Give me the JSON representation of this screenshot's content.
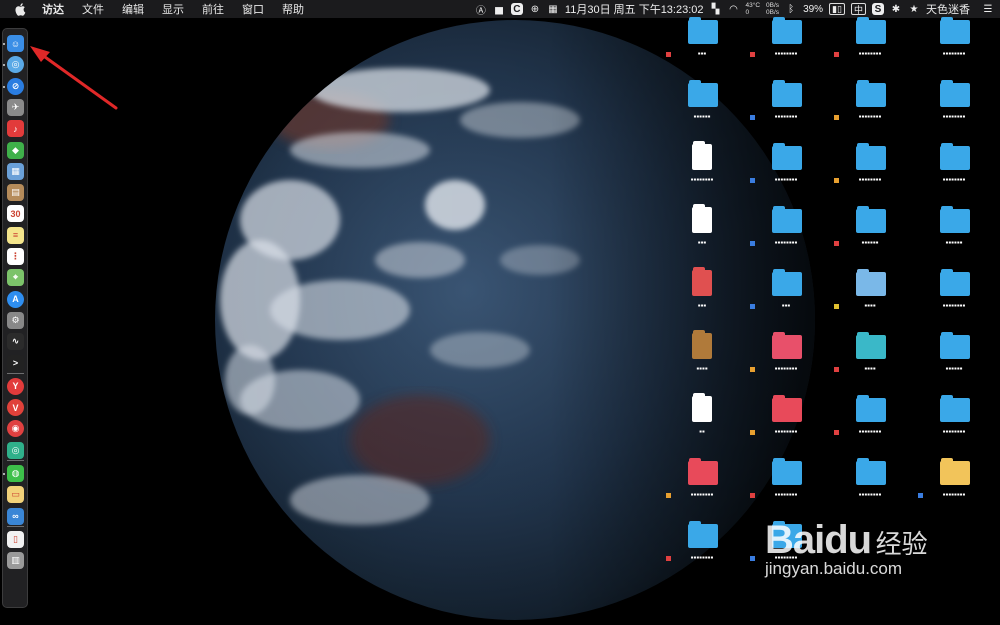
{
  "menubar": {
    "app": "访达",
    "items": [
      "文件",
      "编辑",
      "显示",
      "前往",
      "窗口",
      "帮助"
    ],
    "status": {
      "net_up": "0B/s",
      "net_down": "0B/s",
      "temp": "43°C",
      "temp_sub": "0",
      "clock": "11月30日 周五 下午13:23:02",
      "battery": "39%",
      "input_method": "中",
      "s_badge": "S",
      "c_badge": "C",
      "theme": "天色迷香"
    }
  },
  "dock": {
    "apps": [
      {
        "name": "finder",
        "color": "#3a8ee6",
        "glyph": "☺"
      },
      {
        "name": "safari-alt",
        "color": "#5aa9e6",
        "glyph": "◎"
      },
      {
        "name": "safari",
        "color": "#2a7de1",
        "glyph": "⊘"
      },
      {
        "name": "launchpad",
        "color": "#8a8a8a",
        "glyph": "✈"
      },
      {
        "name": "netease",
        "color": "#e23b3b",
        "glyph": "♪"
      },
      {
        "name": "android",
        "color": "#3fb04a",
        "glyph": "◆"
      },
      {
        "name": "preview",
        "color": "#6aa0d8",
        "glyph": "▦"
      },
      {
        "name": "contacts",
        "color": "#b58b5a",
        "glyph": "▤"
      },
      {
        "name": "calendar",
        "color": "#ffffff",
        "glyph": "30"
      },
      {
        "name": "notes",
        "color": "#f4e58c",
        "glyph": "≡"
      },
      {
        "name": "reminders",
        "color": "#ffffff",
        "glyph": "⋮"
      },
      {
        "name": "maps",
        "color": "#7cc36a",
        "glyph": "⌖"
      },
      {
        "name": "app-store",
        "color": "#2e8ef0",
        "glyph": "A"
      },
      {
        "name": "system-preferences",
        "color": "#888888",
        "glyph": "⚙"
      },
      {
        "name": "activity-monitor",
        "color": "#2b2b2b",
        "glyph": "∿"
      },
      {
        "name": "terminal",
        "color": "#222222",
        "glyph": ">"
      },
      {
        "name": "yandex",
        "color": "#e23b3b",
        "glyph": "Y"
      },
      {
        "name": "vivaldi",
        "color": "#e0413a",
        "glyph": "V"
      },
      {
        "name": "weibo",
        "color": "#e04040",
        "glyph": "◉"
      },
      {
        "name": "green-app",
        "color": "#2fb08a",
        "glyph": "◎"
      },
      {
        "name": "wechat",
        "color": "#3dc04a",
        "glyph": "◍"
      },
      {
        "name": "sticky",
        "color": "#f2d27a",
        "glyph": "▭"
      },
      {
        "name": "infinity",
        "color": "#3a86d6",
        "glyph": "∞"
      },
      {
        "name": "document",
        "color": "#f2f2f2",
        "glyph": "▯"
      },
      {
        "name": "trash",
        "color": "#9a9a9a",
        "glyph": "▥"
      }
    ]
  },
  "desktop": {
    "items": [
      {
        "kind": "folder",
        "color": "#3aa8e8",
        "tag": "#e04040",
        "label": "▪▪▪"
      },
      {
        "kind": "folder",
        "color": "#3aa8e8",
        "tag": "#e04040",
        "label": "▪▪▪▪▪▪▪▪"
      },
      {
        "kind": "folder",
        "color": "#3aa8e8",
        "tag": "#e04040",
        "label": "▪▪▪▪▪▪▪▪"
      },
      {
        "kind": "folder",
        "color": "#3aa8e8",
        "tag": "",
        "label": "▪▪▪▪▪▪▪▪"
      },
      {
        "kind": "folder",
        "color": "#3aa8e8",
        "tag": "",
        "label": "▪▪▪▪▪▪"
      },
      {
        "kind": "folder",
        "color": "#3aa8e8",
        "tag": "#3a7de0",
        "label": "▪▪▪▪▪▪▪▪"
      },
      {
        "kind": "folder",
        "color": "#3aa8e8",
        "tag": "#e8a030",
        "label": "▪▪▪▪▪▪▪▪"
      },
      {
        "kind": "folder",
        "color": "#3aa8e8",
        "tag": "",
        "label": "▪▪▪▪▪▪▪▪"
      },
      {
        "kind": "file",
        "color": "#ffffff",
        "tag": "",
        "label": "▪▪▪▪▪▪▪▪"
      },
      {
        "kind": "folder",
        "color": "#3aa8e8",
        "tag": "#3a7de0",
        "label": "▪▪▪▪▪▪▪▪"
      },
      {
        "kind": "folder",
        "color": "#3aa8e8",
        "tag": "#e8a030",
        "label": "▪▪▪▪▪▪▪▪"
      },
      {
        "kind": "folder",
        "color": "#3aa8e8",
        "tag": "",
        "label": "▪▪▪▪▪▪▪▪"
      },
      {
        "kind": "file",
        "color": "#ffffff",
        "tag": "",
        "label": "▪▪▪"
      },
      {
        "kind": "folder",
        "color": "#3aa8e8",
        "tag": "#3a7de0",
        "label": "▪▪▪▪▪▪▪▪"
      },
      {
        "kind": "folder",
        "color": "#3aa8e8",
        "tag": "#e04040",
        "label": "▪▪▪▪▪▪"
      },
      {
        "kind": "folder",
        "color": "#3aa8e8",
        "tag": "",
        "label": "▪▪▪▪▪▪"
      },
      {
        "kind": "file",
        "color": "#e05050",
        "tag": "",
        "label": "▪▪▪"
      },
      {
        "kind": "folder",
        "color": "#3aa8e8",
        "tag": "#3a7de0",
        "label": "▪▪▪"
      },
      {
        "kind": "folder",
        "color": "#7ab8e8",
        "tag": "#e0c030",
        "label": "▪▪▪▪"
      },
      {
        "kind": "folder",
        "color": "#3aa8e8",
        "tag": "",
        "label": "▪▪▪▪▪▪▪▪"
      },
      {
        "kind": "file",
        "color": "#b07a3a",
        "tag": "",
        "label": "▪▪▪▪"
      },
      {
        "kind": "folder",
        "color": "#e8506a",
        "tag": "#e8a030",
        "label": "▪▪▪▪▪▪▪▪"
      },
      {
        "kind": "folder",
        "color": "#3ab8c8",
        "tag": "#e04040",
        "label": "▪▪▪▪"
      },
      {
        "kind": "folder",
        "color": "#3aa8e8",
        "tag": "",
        "label": "▪▪▪▪▪▪"
      },
      {
        "kind": "file",
        "color": "#ffffff",
        "tag": "",
        "label": "▪▪"
      },
      {
        "kind": "folder",
        "color": "#e84a5a",
        "tag": "#e8a030",
        "label": "▪▪▪▪▪▪▪▪"
      },
      {
        "kind": "folder",
        "color": "#3aa8e8",
        "tag": "#e04040",
        "label": "▪▪▪▪▪▪▪▪"
      },
      {
        "kind": "folder",
        "color": "#3aa8e8",
        "tag": "",
        "label": "▪▪▪▪▪▪▪▪"
      },
      {
        "kind": "folder",
        "color": "#e84a5a",
        "tag": "#e8a030",
        "label": "▪▪▪▪▪▪▪▪"
      },
      {
        "kind": "folder",
        "color": "#3aa8e8",
        "tag": "#e04040",
        "label": "▪▪▪▪▪▪▪▪"
      },
      {
        "kind": "folder",
        "color": "#3aa8e8",
        "tag": "",
        "label": "▪▪▪▪▪▪▪▪"
      },
      {
        "kind": "folder",
        "color": "#f2c45a",
        "tag": "#3a7de0",
        "label": "▪▪▪▪▪▪▪▪"
      },
      {
        "kind": "folder",
        "color": "#3aa8e8",
        "tag": "#e04040",
        "label": "▪▪▪▪▪▪▪▪"
      },
      {
        "kind": "folder",
        "color": "#3aa8e8",
        "tag": "#3a7de0",
        "label": "▪▪▪▪▪▪▪▪"
      }
    ]
  },
  "watermark": {
    "logo_latin": "Bai",
    "logo_paw": "du",
    "logo_cn": "经验",
    "domain": "jingyan.baidu.com"
  },
  "colors": {
    "annotation_arrow": "#e02828",
    "menubar_bg": "#1b1b1d"
  }
}
